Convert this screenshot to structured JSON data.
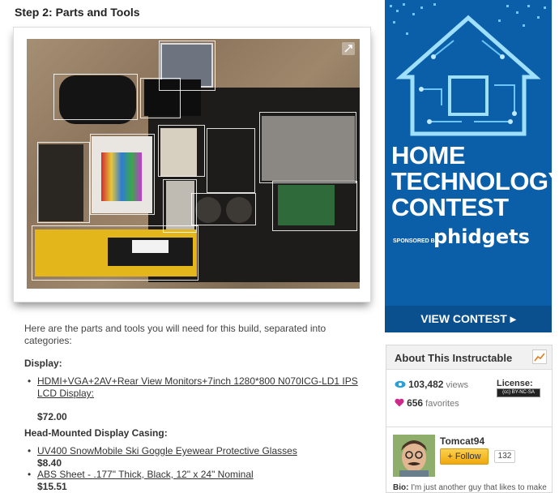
{
  "step": {
    "title": "Step 2: Parts and Tools"
  },
  "intro": "Here are the parts and tools you will need for this build, separated into categories:",
  "sections": [
    {
      "heading": "Display:",
      "items": [
        {
          "label": "HDMI+VGA+2AV+Rear View Monitors+7inch 1280*800 N070ICG-LD1 IPS LCD Display:",
          "price": "$72.00"
        }
      ]
    },
    {
      "heading": "Head-Mounted Display Casing:",
      "items": [
        {
          "label": "UV400 SnowMobile Ski Goggle Eyewear Protective Glasses",
          "price": "$8.40"
        },
        {
          "label": "ABS Sheet - .177\" Thick, Black, 12\" x 24\" Nominal",
          "price": "$15.51"
        }
      ]
    }
  ],
  "bullet_char": "•",
  "ad": {
    "title_lines": [
      "HOME",
      "TECHNOLOGY",
      "CONTEST"
    ],
    "sponsor_label": "SPONSORED BY",
    "brand": "phidgets",
    "button_label": "VIEW CONTEST ▸",
    "bg_color": "#0b5fa8"
  },
  "about": {
    "title": "About This Instructable",
    "views_count": "103,482",
    "views_label": "views",
    "favorites_count": "656",
    "favorites_label": "favorites",
    "license_label": "License:",
    "license_badge": "(cc) BY-NC-SA",
    "author": "Tomcat94",
    "follow_label": "Follow",
    "follow_plus": "+",
    "follower_count": "132",
    "bio_label": "Bio:",
    "bio_text": "I'm just another guy that likes to make"
  },
  "icons": {
    "expand": "expand-icon",
    "views": "eye-icon",
    "favorites": "heart-icon",
    "stats": "stats-chart-icon"
  },
  "colors": {
    "views": "#2a9fd6",
    "favorites": "#cc2a8c",
    "follow": "#f0a90e"
  }
}
